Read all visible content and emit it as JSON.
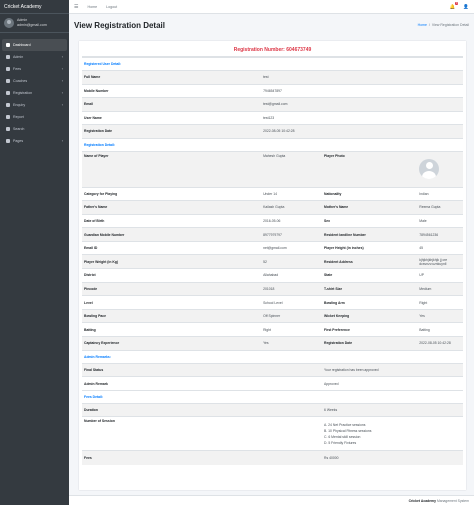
{
  "brand": "Cricket Academy",
  "user": {
    "name": "Admin",
    "email": "admin@gmail.com"
  },
  "sidebar": {
    "items": [
      {
        "label": "Dashboard",
        "icon": "dashboard-icon",
        "active": true,
        "caret": ""
      },
      {
        "label": "Admin",
        "icon": "user-icon",
        "caret": "‹"
      },
      {
        "label": "Fees",
        "icon": "money-icon",
        "caret": "‹"
      },
      {
        "label": "Coaches",
        "icon": "coach-icon",
        "caret": "‹"
      },
      {
        "label": "Registration",
        "icon": "registration-icon",
        "caret": "‹"
      },
      {
        "label": "Enquiry",
        "icon": "enquiry-icon",
        "caret": "‹"
      },
      {
        "label": "Report",
        "icon": "report-icon",
        "caret": ""
      },
      {
        "label": "Search",
        "icon": "search-icon",
        "caret": ""
      },
      {
        "label": "Pages",
        "icon": "pages-icon",
        "caret": "‹"
      }
    ]
  },
  "topbar": {
    "home": "Home",
    "logout": "Logout",
    "menu_icon": "☰",
    "bell_icon": "🔔",
    "bell_badge": "3",
    "profile_icon": "👤"
  },
  "header": {
    "title": "View Registration Detail",
    "crumb_home": "Home",
    "crumb_sep": "/",
    "crumb_current": "View Registration Detail"
  },
  "registration": {
    "label": "Registration Number: 604673749"
  },
  "sections": {
    "user": "Registered User Detail:",
    "reg": "Registration Detail:",
    "admin": "Admin Remarks:",
    "fees": "Fees Detail:"
  },
  "user_detail": [
    {
      "label": "Full Name",
      "value": "test"
    },
    {
      "label": "Mobile Number",
      "value": "7946547897"
    },
    {
      "label": "Email",
      "value": "test@gmail.com"
    },
    {
      "label": "User Name",
      "value": "test123"
    },
    {
      "label": "Registration Date",
      "value": "2022-08-05 10:42:28"
    }
  ],
  "reg_top": {
    "l1": "Name of Player",
    "v1": "Mahesh Gupta",
    "l2": "Player Photo"
  },
  "reg_rows": [
    {
      "l1": "Category for Playing",
      "v1": "Under 14",
      "l2": "Nationality",
      "v2": "Indian"
    },
    {
      "l1": "Father's Name",
      "v1": "Kailash Gupta",
      "l2": "Mother's Name",
      "v2": "Reema Gupta"
    },
    {
      "l1": "Date of Birth",
      "v1": "2016-05-06",
      "l2": "Sex",
      "v2": "Male"
    },
    {
      "l1": "Guardian Mobile Number",
      "v1": "8977979797",
      "l2": "Resident landline Number",
      "v2": "7894561236"
    },
    {
      "l1": "Email ID",
      "v1": "net@gmail.com",
      "l2": "Player Height (in inches)",
      "v2": "45"
    },
    {
      "l1": "Player Weight (in Kg)",
      "v1": "52",
      "l2": "Resident Address",
      "v2": "kjhjkhjkhjkhjk jj cre dcsvnzv.uznkuynll"
    },
    {
      "l1": "District",
      "v1": "Allahabad",
      "l2": "State",
      "v2": "UP"
    },
    {
      "l1": "Pincode",
      "v1": "201018",
      "l2": "T-shirt Size",
      "v2": "Medium"
    },
    {
      "l1": "Bowling Pace",
      "v1": "School Level",
      "l2": "Bowling Arm",
      "v2": "Right",
      "fix_l1": "Level"
    },
    {
      "l1": "Bowling Pace",
      "v1": "Off Spinner",
      "l2": "Wicket Keeping",
      "v2": "Yes"
    },
    {
      "l1": "Batting",
      "v1": "Right",
      "l2": "First Preference",
      "v2": "Batting"
    },
    {
      "l1": "Captaincy Experience",
      "v1": "Yes",
      "l2": "Registration Date",
      "v2": "2022-08-05 10:42:28"
    }
  ],
  "admin_rows": [
    {
      "label": "Final Status",
      "value": "Your registration has been approved"
    },
    {
      "label": "Admin Remark",
      "value": "Approved"
    }
  ],
  "fees_rows": {
    "duration_label": "Duration",
    "duration_value": "6 Weeks",
    "sessions_label": "Number of Session",
    "sessions": [
      "A. 24 Net Practice sessions",
      "B. 10 Physical Fitness sessions",
      "C. 6 Mental skill session",
      "D. 5 Friendly Fixtures"
    ],
    "fees_label": "Fees",
    "fees_value": "Rs 40000"
  },
  "footer": {
    "brand": "Cricket Academy",
    "rest": "Management System"
  }
}
